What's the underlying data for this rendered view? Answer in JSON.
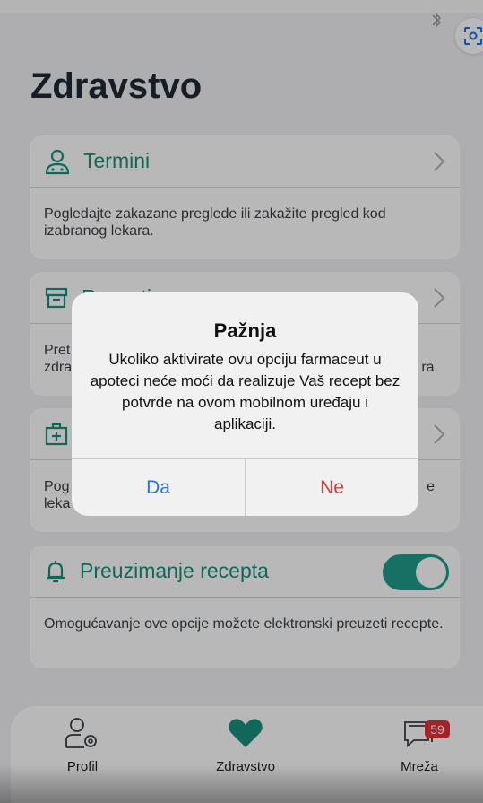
{
  "header": {
    "title": "Zdravstvo"
  },
  "cards": [
    {
      "title": "Termini",
      "body": "Pogledajte zakazane preglede ili zakažite pregled kod izabranog lekara.",
      "icon": "doctor-icon"
    },
    {
      "title": "Recepti",
      "body_left_1": "Pret",
      "body_left_2": "zdra",
      "body_right": "ra.",
      "icon": "archive-box-icon"
    },
    {
      "title": "",
      "body_left_1": "Pog",
      "body_left_2": "leka",
      "body_right": "e",
      "icon": "medical-kit-icon"
    },
    {
      "title": "Preuzimanje recepta",
      "body": "Omogućavanje ove opcije možete elektronski preuzeti recepte.",
      "icon": "bell-icon",
      "toggle_on": true
    }
  ],
  "alert": {
    "title": "Pažnja",
    "message": "Ukoliko aktivirate ovu opciju farmaceut u apoteci neće moći da realizuje Vaš recept bez potvrde na ovom mobilnom uređaju i aplikaciji.",
    "confirm_label": "Da",
    "cancel_label": "Ne"
  },
  "tabbar": {
    "items": [
      {
        "label": "Profil",
        "icon": "profile-settings-icon"
      },
      {
        "label": "Zdravstvo",
        "icon": "heart-icon",
        "active": true
      },
      {
        "label": "Mreža",
        "icon": "chat-bubbles-icon",
        "badge": "59"
      }
    ]
  },
  "colors": {
    "accent": "#1a8f7e",
    "badge": "#e0323a",
    "confirm": "#2b72d8",
    "cancel": "#e03a3a"
  }
}
